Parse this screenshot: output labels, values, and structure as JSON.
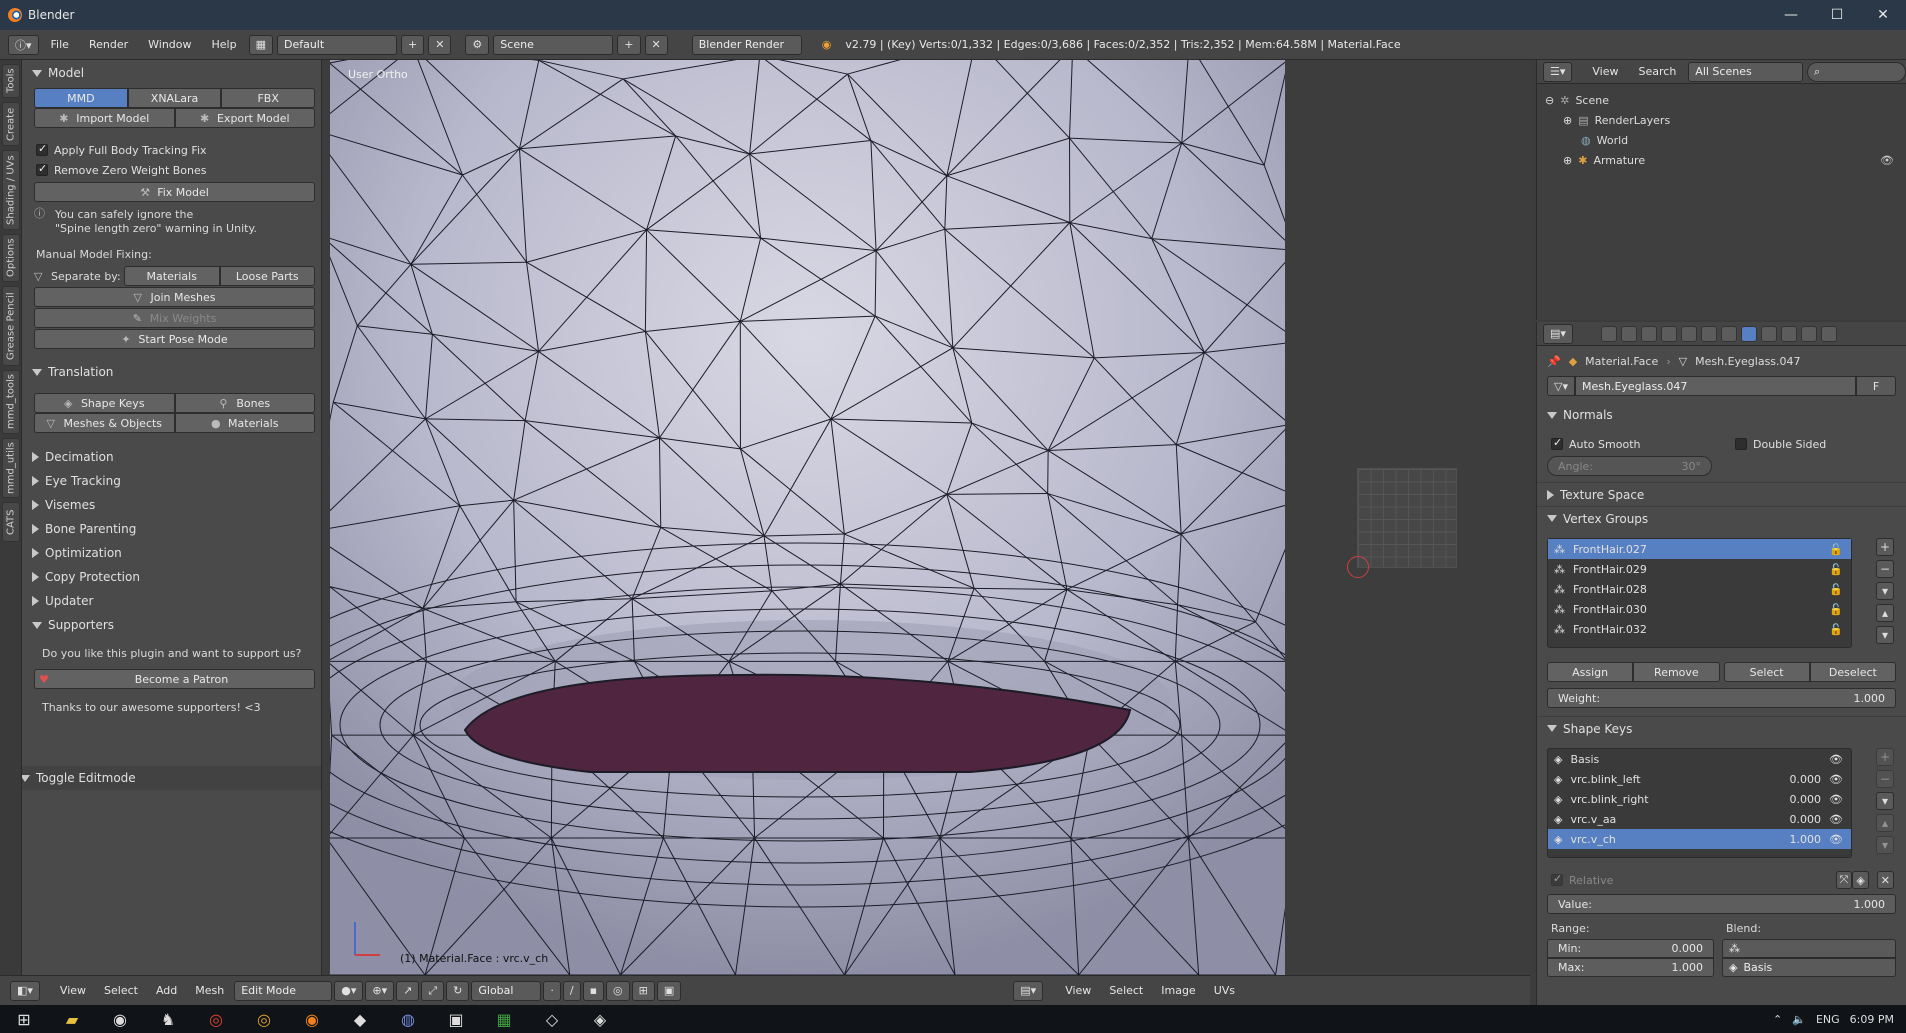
{
  "window": {
    "title": "Blender",
    "min": "—",
    "max": "☐",
    "close": "✕"
  },
  "info": {
    "menus": [
      "File",
      "Render",
      "Window",
      "Help"
    ],
    "layout": "Default",
    "scene": "Scene",
    "engine": "Blender Render",
    "stats": "v2.79 | (Key) Verts:0/1,332 | Edges:0/3,686 | Faces:0/2,352 | Tris:2,352 | Mem:64.58M | Material.Face"
  },
  "tabs": [
    "Tools",
    "Create",
    "Shading / UVs",
    "Options",
    "Grease Pencil",
    "mmd_tools",
    "mmd_utils",
    "CATS"
  ],
  "model": {
    "header": "Model",
    "export_tabs": [
      "MMD",
      "XNALara",
      "FBX"
    ],
    "import_label": "Import Model",
    "export_label": "Export Model",
    "check1": "Apply Full Body Tracking Fix",
    "check2": "Remove Zero Weight Bones",
    "fix_label": "Fix Model",
    "info1": "You can safely ignore the",
    "info2": "\"Spine length zero\" warning in Unity.",
    "manual_label": "Manual Model Fixing:",
    "separate_label": "Separate by:",
    "sep_materials": "Materials",
    "sep_loose": "Loose Parts",
    "join_label": "Join Meshes",
    "mix_label": "Mix Weights",
    "pose_label": "Start Pose Mode"
  },
  "translation": {
    "header": "Translation",
    "shape_keys": "Shape Keys",
    "bones": "Bones",
    "meshes": "Meshes & Objects",
    "materials": "Materials"
  },
  "sections": [
    "Decimation",
    "Eye Tracking",
    "Visemes",
    "Bone Parenting",
    "Optimization",
    "Copy Protection",
    "Updater"
  ],
  "supporters": {
    "header": "Supporters",
    "question": "Do you like this plugin and want to support us?",
    "patron_label": "Become a Patron",
    "thanks": "Thanks to our awesome supporters! <3"
  },
  "toggle_editmode": "Toggle Editmode",
  "viewport": {
    "view_label": "User Ortho",
    "object_label": "(1) Material.Face : vrc.v_ch",
    "mouth_color": "#4f2540"
  },
  "bottombar": {
    "menus": [
      "View",
      "Select",
      "Add",
      "Mesh"
    ],
    "mode": "Edit Mode",
    "orientation": "Global",
    "uv_menus": [
      "View",
      "Select",
      "Image",
      "UVs"
    ]
  },
  "outliner": {
    "menus": [
      "View",
      "Search"
    ],
    "scenes": "All Scenes",
    "items": [
      "Scene",
      "RenderLayers",
      "World",
      "Armature"
    ]
  },
  "properties": {
    "breadcrumb_material": "Material.Face",
    "breadcrumb_mesh": "Mesh.Eyeglass.047",
    "mesh_name": "Mesh.Eyeglass.047",
    "fake_user": "F",
    "normals": {
      "header": "Normals",
      "auto_smooth": "Auto Smooth",
      "double_sided": "Double Sided",
      "angle_label": "Angle:",
      "angle_value": "30°"
    },
    "texture_space": "Texture Space",
    "vertex_groups": {
      "header": "Vertex Groups",
      "items": [
        "FrontHair.027",
        "FrontHair.029",
        "FrontHair.028",
        "FrontHair.030",
        "FrontHair.032"
      ],
      "assign": "Assign",
      "remove": "Remove",
      "select": "Select",
      "deselect": "Deselect",
      "weight_label": "Weight:",
      "weight_value": "1.000"
    },
    "shape_keys": {
      "header": "Shape Keys",
      "items": [
        {
          "name": "Basis",
          "value": ""
        },
        {
          "name": "vrc.blink_left",
          "value": "0.000"
        },
        {
          "name": "vrc.blink_right",
          "value": "0.000"
        },
        {
          "name": "vrc.v_aa",
          "value": "0.000"
        },
        {
          "name": "vrc.v_ch",
          "value": "1.000"
        }
      ],
      "relative": "Relative",
      "value_label": "Value:",
      "value": "1.000",
      "range_label": "Range:",
      "blend_label": "Blend:",
      "min_label": "Min:",
      "min_value": "0.000",
      "max_label": "Max:",
      "max_value": "1.000",
      "blend_value": "Basis"
    }
  },
  "taskbar": {
    "lang": "ENG",
    "time": "6:09 PM"
  }
}
